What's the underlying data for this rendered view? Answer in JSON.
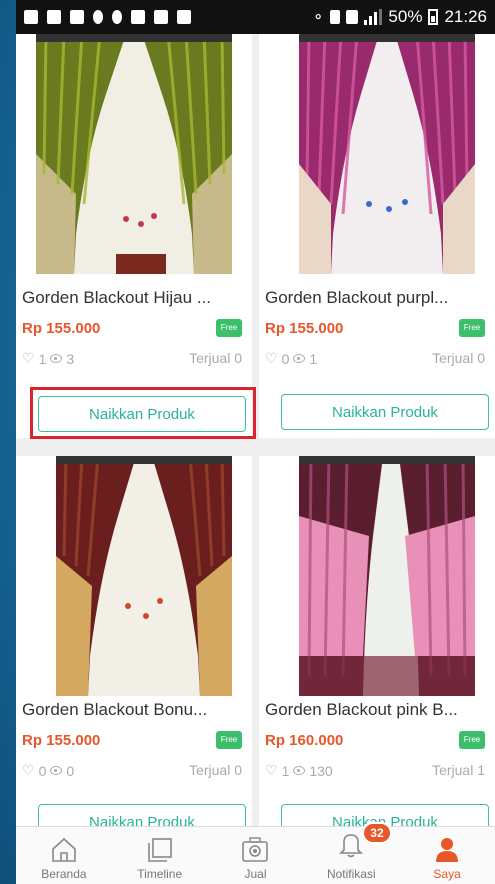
{
  "status_bar": {
    "battery": "50%",
    "time": "21:26"
  },
  "products": [
    {
      "name": "Gorden Blackout Hijau ...",
      "price": "Rp 155.000",
      "free_badge": "Free",
      "likes": "1",
      "views": "3",
      "sold": "Terjual 0",
      "button": "Naikkan Produk",
      "colors": {
        "curtain": "#6a7a1e",
        "accent": "#a8b832"
      }
    },
    {
      "name": "Gorden Blackout purpl...",
      "price": "Rp 155.000",
      "free_badge": "Free",
      "likes": "0",
      "views": "1",
      "sold": "Terjual 0",
      "button": "Naikkan Produk",
      "colors": {
        "curtain": "#9a2a6e",
        "accent": "#d65aa0"
      }
    },
    {
      "name": "Gorden Blackout Bonu...",
      "price": "Rp 155.000",
      "free_badge": "Free",
      "likes": "0",
      "views": "0",
      "sold": "Terjual 0",
      "button": "Naikkan Produk",
      "colors": {
        "curtain": "#6a1e1e",
        "accent": "#d4a860"
      }
    },
    {
      "name": "Gorden Blackout pink B...",
      "price": "Rp 160.000",
      "free_badge": "Free",
      "likes": "1",
      "views": "130",
      "sold": "Terjual 1",
      "button": "Naikkan Produk",
      "colors": {
        "curtain": "#5a1e2e",
        "accent": "#e890b8"
      }
    }
  ],
  "nav": {
    "items": [
      {
        "label": "Beranda",
        "icon": "home-icon"
      },
      {
        "label": "Timeline",
        "icon": "timeline-icon"
      },
      {
        "label": "Jual",
        "icon": "camera-icon"
      },
      {
        "label": "Notifikasi",
        "icon": "bell-icon",
        "badge": "32"
      },
      {
        "label": "Saya",
        "icon": "user-icon"
      }
    ]
  },
  "theme": {
    "price_color": "#e8562a",
    "button_color": "#2ab49a",
    "highlight_color": "#d9232e",
    "free_color": "#3bbf6b"
  }
}
